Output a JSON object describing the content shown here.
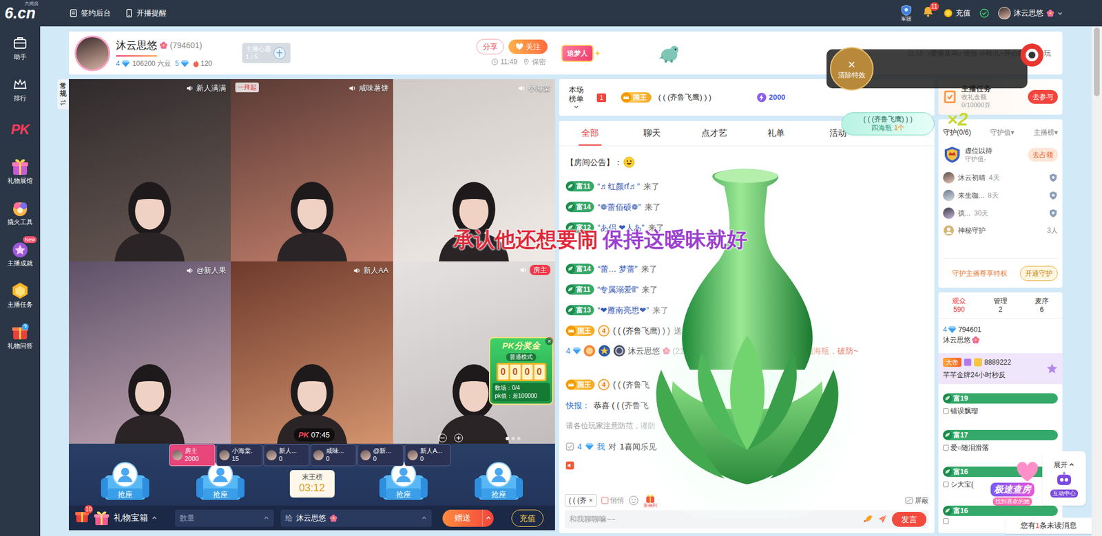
{
  "topbar": {
    "logo": "6.cn",
    "logo_sub": "六间房",
    "links": [
      "签约后台",
      "开播提醒"
    ],
    "legion": "军团",
    "bell_count": "11",
    "recharge": "充值",
    "user": "沐云思悠"
  },
  "sidebar": [
    {
      "label": "助手",
      "kind": "icon"
    },
    {
      "label": "排行",
      "kind": "icon"
    },
    {
      "label": "PK",
      "kind": "logo"
    },
    {
      "label": "礼物展馆",
      "kind": "icon"
    },
    {
      "label": "撬火工具",
      "kind": "icon"
    },
    {
      "label": "主播成就",
      "kind": "icon",
      "badge": "New"
    },
    {
      "label": "主播任务",
      "kind": "icon"
    },
    {
      "label": "礼物问答",
      "kind": "icon"
    }
  ],
  "anchor": {
    "name": "沐云思悠",
    "id": "(794601)",
    "level": "4",
    "beans": "106200 六豆",
    "fortune_level": "5",
    "fans": "120",
    "wish_label": "主播心愿",
    "wish_count": "1 / 5",
    "share": "分享",
    "follow": "关注",
    "badge": "追梦人",
    "time": "11:49",
    "location": "保密"
  },
  "marquee": {
    "time": "11:55",
    "text": "♪爱屋及乌♪ 送给 小玲儿~开心就好 1个玩"
  },
  "clear_effect": {
    "icon": "×",
    "label": "清除特效"
  },
  "video": {
    "mode_tab": "常规",
    "tiles": [
      {
        "name": "新人满满",
        "host": false
      },
      {
        "name": "咸味薯饼",
        "host": false,
        "tag": "一拜起"
      },
      {
        "name": "小海棠",
        "host": false
      },
      {
        "name": "@新人果",
        "host": false
      },
      {
        "name": "新人AA",
        "host": false
      },
      {
        "name": "房主",
        "host": true
      }
    ],
    "pk_timer": {
      "logo": "PK",
      "time": "07:45"
    },
    "pk_prize": {
      "title": "PK分奖金",
      "mode": "普通模式",
      "digits": [
        "0",
        "0",
        "0",
        "0"
      ],
      "rounds": "数场：0/4",
      "gap": "pk值：差100000",
      "close": "×"
    },
    "seats": [
      "抢座",
      "抢座",
      "抢座",
      "抢座"
    ],
    "scores": [
      {
        "name": "房主",
        "score": "2000",
        "host": true
      },
      {
        "name": "小海棠.",
        "score": "15",
        "host": false
      },
      {
        "name": "新人...",
        "score": "0",
        "host": false
      },
      {
        "name": "咸味...",
        "score": "0",
        "host": false
      },
      {
        "name": "@新...",
        "score": "0",
        "host": false
      },
      {
        "name": "新人A...",
        "score": "0",
        "host": false
      }
    ],
    "last_rank": {
      "label": "末王榜",
      "time": "03:12"
    }
  },
  "gift_bar": {
    "box_badge": "10",
    "box_label": "礼物宝箱",
    "qty_placeholder": "数量",
    "to_label": "给",
    "to_name": "沐云思悠",
    "send": "赠送",
    "recharge": "充值"
  },
  "chat": {
    "ranking": {
      "label": "本场榜单",
      "rank": "1",
      "title": "国王",
      "user": "( ( (齐鲁飞鹰) ) )",
      "score": "2000"
    },
    "tabs": [
      {
        "label": "全部",
        "selected": true
      },
      {
        "label": "聊天",
        "selected": false
      },
      {
        "label": "点才艺",
        "selected": false
      },
      {
        "label": "礼单",
        "selected": false
      },
      {
        "label": "活动",
        "selected": false
      }
    ],
    "messages": [
      {
        "kind": "notice",
        "text": "【房间公告】："
      },
      {
        "kind": "enter",
        "rich": "富11",
        "user": "“♬红颜rf♬”",
        "text": "来了"
      },
      {
        "kind": "enter",
        "rich": "富14",
        "user": "“❁蕾佰硕❁”",
        "text": "来了"
      },
      {
        "kind": "enter",
        "rich": "富12",
        "user": "“あ侣 ❤人あ”",
        "text": "来了"
      },
      {
        "kind": "covered"
      },
      {
        "kind": "enter",
        "rich": "富14",
        "user": "“蕾… 梦蕾”",
        "text": "来了"
      },
      {
        "kind": "enter",
        "rich": "富11",
        "user": "“专属溺爱ll”",
        "text": "来了"
      },
      {
        "kind": "enter",
        "rich": "富13",
        "user": "“❤雁南亮思❤”",
        "text": "来了"
      },
      {
        "kind": "gift",
        "title": "国王",
        "level": "4",
        "user": "( ( (齐鲁飞鹰) ) )",
        "text": "送1个"
      },
      {
        "kind": "say",
        "level": "4",
        "user": "沐云思悠",
        "uid": "(214752) 说：",
        "text": "( ( (齐鲁飞鹰) ) ) 送1个四海瓶，破防~"
      },
      {
        "kind": "gift",
        "title": "国王",
        "level": "4",
        "user": "( ( (齐鲁飞",
        "text": ""
      },
      {
        "kind": "flash",
        "label": "快报：",
        "text": "恭喜 ( ( (齐鲁飞"
      },
      {
        "kind": "warning",
        "text": "请各位玩家注意防范，谨防"
      },
      {
        "kind": "me",
        "level": "4",
        "user": "我",
        "text": "对",
        "target": "1喜闻乐见"
      }
    ],
    "input": {
      "target": "( ( (齐",
      "close": "×",
      "quiet": "悄悄",
      "quiet_checked": false,
      "welfare": "发福利",
      "shield": "屏蔽",
      "placeholder": "和我聊聊嘛~~",
      "send": "发言"
    }
  },
  "effect": {
    "lyric_a": "承认他还想要闹",
    "lyric_b": "保持这暧昧就好",
    "popup": {
      "user": "( ( (齐鲁飞鹰) ) )",
      "gift": "四海瓶",
      "count": "1个",
      "multiplier": "×2"
    }
  },
  "task": {
    "title": "主播任务",
    "desc": "收礼金额",
    "progress": "0/10000豆",
    "button": "去参与"
  },
  "guard": {
    "tabs": [
      {
        "label": "守护(0/6)",
        "selected": true
      },
      {
        "label": "守护值▾",
        "selected": false
      },
      {
        "label": "主播榜▾",
        "selected": false
      }
    ],
    "vacant": {
      "name": "虚位以待",
      "sub": "守护值-",
      "button": "去占领"
    },
    "members": [
      {
        "name": "沐云初晴",
        "days": "4天"
      },
      {
        "name": "来生咖...",
        "days": "8天"
      },
      {
        "name": "孩...",
        "days": "30天"
      }
    ],
    "mystery": {
      "name": "神秘守护",
      "count": "3人"
    },
    "privilege": "守护主播尊享特权",
    "open": "开通守护"
  },
  "audience": {
    "tabs": [
      {
        "label": "观众",
        "count": "590",
        "selected": true
      },
      {
        "label": "管理",
        "count": "2",
        "selected": false
      },
      {
        "label": "麦序",
        "count": "6",
        "selected": false
      }
    ],
    "users": [
      {
        "kind": "anchor",
        "level": "4",
        "id": "794601",
        "name": "沐云思悠"
      },
      {
        "kind": "vip",
        "title": "大帝",
        "id": "8889222",
        "name": "芊芊金牌24小时秒反"
      },
      {
        "kind": "rich",
        "rich": "富19",
        "name": "错误飘瑠"
      },
      {
        "kind": "rich",
        "rich": "富17",
        "name": "爱○随泪滑落"
      },
      {
        "kind": "rich",
        "rich": "富16",
        "name": "シ大宝("
      },
      {
        "kind": "rich",
        "rich": "富16",
        "name": ""
      }
    ]
  },
  "floating": {
    "expand": "展开",
    "interact": "互动中心",
    "quick": "极速查房",
    "quick_sub": "找到喜欢的她",
    "unread_a": "您有",
    "unread_n": "1",
    "unread_b": "条未读消息"
  }
}
